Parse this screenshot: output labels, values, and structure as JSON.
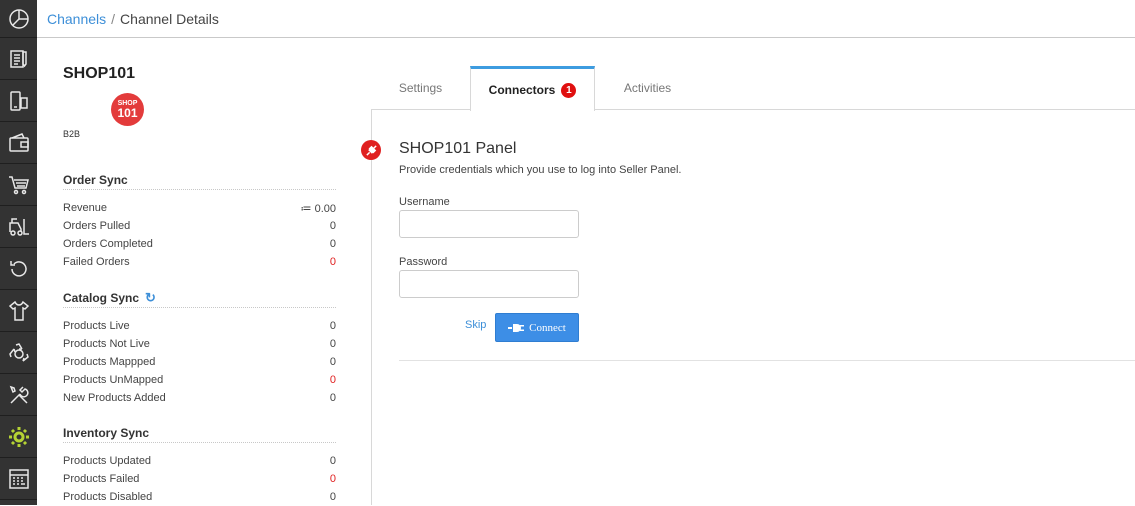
{
  "breadcrumb": {
    "link": "Channels",
    "separator": "/",
    "current": "Channel Details"
  },
  "sidebar": {
    "icons": [
      "dashboard-icon",
      "orders-icon",
      "devices-icon",
      "wallet-icon",
      "cart-icon",
      "forklift-icon",
      "returns-icon",
      "apparel-icon",
      "recycle-icon",
      "tools-icon",
      "settings-icon",
      "calculator-icon"
    ],
    "active": "settings-icon"
  },
  "channel": {
    "name": "SHOP101",
    "logo_text_top": "SHOP",
    "logo_text_bottom": "101",
    "type": "B2B"
  },
  "order_sync": {
    "title": "Order Sync",
    "rows": [
      {
        "label": "Revenue",
        "value": "≔ 0.00",
        "alert": false
      },
      {
        "label": "Orders Pulled",
        "value": "0",
        "alert": false
      },
      {
        "label": "Orders Completed",
        "value": "0",
        "alert": false
      },
      {
        "label": "Failed Orders",
        "value": "0",
        "alert": true
      }
    ]
  },
  "catalog_sync": {
    "title": "Catalog Sync",
    "rows": [
      {
        "label": "Products Live",
        "value": "0",
        "alert": false
      },
      {
        "label": "Products Not Live",
        "value": "0",
        "alert": false
      },
      {
        "label": "Products Mappped",
        "value": "0",
        "alert": false
      },
      {
        "label": "Products UnMapped",
        "value": "0",
        "alert": true
      },
      {
        "label": "New Products Added",
        "value": "0",
        "alert": false
      }
    ]
  },
  "inventory_sync": {
    "title": "Inventory Sync",
    "rows": [
      {
        "label": "Products Updated",
        "value": "0",
        "alert": false
      },
      {
        "label": "Products Failed",
        "value": "0",
        "alert": true
      },
      {
        "label": "Products Disabled",
        "value": "0",
        "alert": false
      }
    ]
  },
  "tabs": {
    "settings": "Settings",
    "connectors": "Connectors",
    "connectors_badge": "1",
    "activities": "Activities",
    "active": "connectors"
  },
  "panel": {
    "title": "SHOP101 Panel",
    "subtitle": "Provide credentials which you use to log into Seller Panel.",
    "username_label": "Username",
    "username_value": "",
    "password_label": "Password",
    "password_value": "",
    "skip_label": "Skip",
    "connect_label": "Connect"
  },
  "colors": {
    "accent": "#3d8ee6",
    "alert": "#e02020",
    "active_icon": "#b5d334",
    "rail_bg": "#333333"
  }
}
